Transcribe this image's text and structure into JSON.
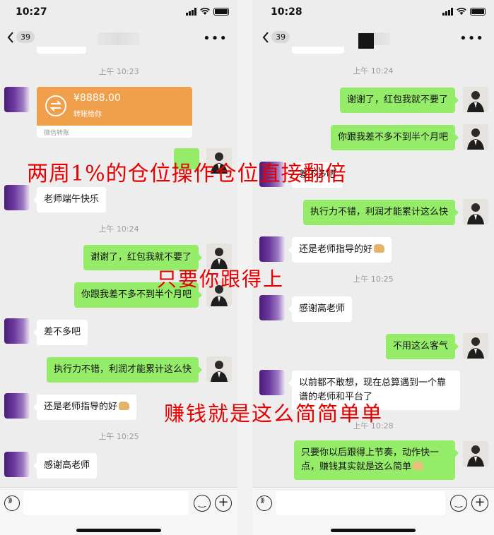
{
  "left": {
    "status_time": "10:27",
    "unread_count": "39",
    "timestamps": [
      "上午 10:23",
      "上午 10:24",
      "上午 10:25"
    ],
    "transfer": {
      "amount": "¥8888.00",
      "note": "转账给你",
      "label": "微信转账"
    },
    "messages": {
      "m1": "老师端午快乐",
      "m2": "谢谢了，红包我就不要了",
      "m3": "你跟我差不多不到半个月吧",
      "m4": "差不多吧",
      "m5": "执行力不错，利润才能累计这么快",
      "m6": "还是老师指导的好",
      "m7": "感谢高老师"
    }
  },
  "right": {
    "status_time": "10:28",
    "unread_count": "39",
    "timestamps": [
      "上午 10:24",
      "上午 10:25",
      "上午 10:28"
    ],
    "messages": {
      "m1": "谢谢了，红包我就不要了",
      "m2": "你跟我差不多不到半个月吧",
      "m3": "差不多吧",
      "m4": "执行力不错，利润才能累计这么快",
      "m5": "还是老师指导的好",
      "m6": "感谢高老师",
      "m7": "不用这么客气",
      "m8": "以前都不敢想，现在总算遇到一个靠谱的老师和平台了",
      "m9": "只要你以后跟得上节奏，动作快一点，赚钱其实就是这么简单"
    }
  },
  "overlays": {
    "line1": "两周1%的仓位操作仓位直接翻倍",
    "line2": "只要你跟得上",
    "line3": "赚钱就是这么简简单单"
  },
  "icons": {
    "back": "chevron-left-icon",
    "more": "more-dots-icon",
    "voice": "voice-icon",
    "emoji": "emoji-icon",
    "plus": "plus-icon",
    "transfer": "transfer-icon",
    "thumb": "thumbs-up-icon"
  },
  "colors": {
    "chat_bg": "#ededed",
    "outgoing_bubble": "#95ec69",
    "incoming_bubble": "#ffffff",
    "transfer_card": "#f0a04b",
    "overlay_text": "#e60000"
  }
}
